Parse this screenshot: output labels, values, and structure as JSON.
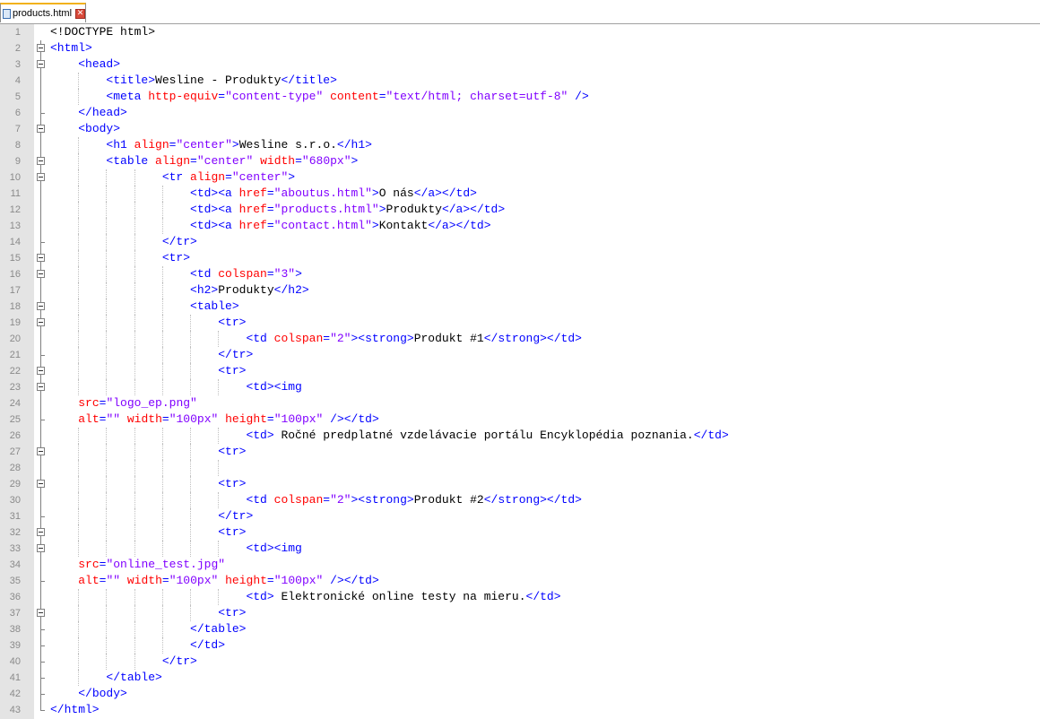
{
  "tab": {
    "file_icon": "html-file-icon",
    "label": "products.html",
    "close_icon": "close-icon"
  },
  "colors": {
    "tag": "#0000ff",
    "attribute": "#ff0000",
    "value": "#8000ff",
    "text": "#000000",
    "gutter": "#e4e4e4"
  },
  "lines": [
    {
      "n": "1",
      "fold": "none",
      "segs": [
        [
          "x",
          "<!DOCTYPE html>"
        ]
      ]
    },
    {
      "n": "2",
      "fold": "open",
      "segs": [
        [
          "t",
          "<html>"
        ]
      ]
    },
    {
      "n": "3",
      "fold": "open",
      "segs": [
        [
          "x",
          "    "
        ],
        [
          "t",
          "<head>"
        ]
      ]
    },
    {
      "n": "4",
      "fold": "line",
      "segs": [
        [
          "x",
          "        "
        ],
        [
          "t",
          "<title>"
        ],
        [
          "x",
          "Wesline - Produkty"
        ],
        [
          "t",
          "</title>"
        ]
      ]
    },
    {
      "n": "5",
      "fold": "line",
      "segs": [
        [
          "x",
          "        "
        ],
        [
          "t",
          "<meta "
        ],
        [
          "a",
          "http-equiv"
        ],
        [
          "t",
          "="
        ],
        [
          "v",
          "\"content-type\""
        ],
        [
          "t",
          " "
        ],
        [
          "a",
          "content"
        ],
        [
          "t",
          "="
        ],
        [
          "v",
          "\"text/html; charset=utf-8\""
        ],
        [
          "t",
          " />"
        ]
      ]
    },
    {
      "n": "6",
      "fold": "end",
      "segs": [
        [
          "x",
          "    "
        ],
        [
          "t",
          "</head>"
        ]
      ]
    },
    {
      "n": "7",
      "fold": "open",
      "segs": [
        [
          "x",
          "    "
        ],
        [
          "t",
          "<body>"
        ]
      ]
    },
    {
      "n": "8",
      "fold": "line",
      "segs": [
        [
          "x",
          "        "
        ],
        [
          "t",
          "<h1 "
        ],
        [
          "a",
          "align"
        ],
        [
          "t",
          "="
        ],
        [
          "v",
          "\"center\""
        ],
        [
          "t",
          ">"
        ],
        [
          "x",
          "Wesline s.r.o."
        ],
        [
          "t",
          "</h1>"
        ]
      ]
    },
    {
      "n": "9",
      "fold": "open",
      "segs": [
        [
          "x",
          "        "
        ],
        [
          "t",
          "<table "
        ],
        [
          "a",
          "align"
        ],
        [
          "t",
          "="
        ],
        [
          "v",
          "\"center\""
        ],
        [
          "t",
          " "
        ],
        [
          "a",
          "width"
        ],
        [
          "t",
          "="
        ],
        [
          "v",
          "\"680px\""
        ],
        [
          "t",
          ">"
        ]
      ]
    },
    {
      "n": "10",
      "fold": "open",
      "segs": [
        [
          "x",
          "                "
        ],
        [
          "t",
          "<tr "
        ],
        [
          "a",
          "align"
        ],
        [
          "t",
          "="
        ],
        [
          "v",
          "\"center\""
        ],
        [
          "t",
          ">"
        ]
      ]
    },
    {
      "n": "11",
      "fold": "line",
      "segs": [
        [
          "x",
          "                    "
        ],
        [
          "t",
          "<td><a "
        ],
        [
          "a",
          "href"
        ],
        [
          "t",
          "="
        ],
        [
          "v",
          "\"aboutus.html\""
        ],
        [
          "t",
          ">"
        ],
        [
          "x",
          "O nás"
        ],
        [
          "t",
          "</a></td>"
        ]
      ]
    },
    {
      "n": "12",
      "fold": "line",
      "segs": [
        [
          "x",
          "                    "
        ],
        [
          "t",
          "<td><a "
        ],
        [
          "a",
          "href"
        ],
        [
          "t",
          "="
        ],
        [
          "v",
          "\"products.html\""
        ],
        [
          "t",
          ">"
        ],
        [
          "x",
          "Produkty"
        ],
        [
          "t",
          "</a></td>"
        ]
      ]
    },
    {
      "n": "13",
      "fold": "line",
      "segs": [
        [
          "x",
          "                    "
        ],
        [
          "t",
          "<td><a "
        ],
        [
          "a",
          "href"
        ],
        [
          "t",
          "="
        ],
        [
          "v",
          "\"contact.html\""
        ],
        [
          "t",
          ">"
        ],
        [
          "x",
          "Kontakt"
        ],
        [
          "t",
          "</a></td>"
        ]
      ]
    },
    {
      "n": "14",
      "fold": "end",
      "segs": [
        [
          "x",
          "                "
        ],
        [
          "t",
          "</tr>"
        ]
      ]
    },
    {
      "n": "15",
      "fold": "open",
      "segs": [
        [
          "x",
          "                "
        ],
        [
          "t",
          "<tr>"
        ]
      ]
    },
    {
      "n": "16",
      "fold": "open",
      "segs": [
        [
          "x",
          "                    "
        ],
        [
          "t",
          "<td "
        ],
        [
          "a",
          "colspan"
        ],
        [
          "t",
          "="
        ],
        [
          "v",
          "\"3\""
        ],
        [
          "t",
          ">"
        ]
      ]
    },
    {
      "n": "17",
      "fold": "line",
      "segs": [
        [
          "x",
          "                    "
        ],
        [
          "t",
          "<h2>"
        ],
        [
          "x",
          "Produkty"
        ],
        [
          "t",
          "</h2>"
        ]
      ]
    },
    {
      "n": "18",
      "fold": "open",
      "segs": [
        [
          "x",
          "                    "
        ],
        [
          "t",
          "<table>"
        ]
      ]
    },
    {
      "n": "19",
      "fold": "open",
      "segs": [
        [
          "x",
          "                        "
        ],
        [
          "t",
          "<tr>"
        ]
      ]
    },
    {
      "n": "20",
      "fold": "line",
      "segs": [
        [
          "x",
          "                            "
        ],
        [
          "t",
          "<td "
        ],
        [
          "a",
          "colspan"
        ],
        [
          "t",
          "="
        ],
        [
          "v",
          "\"2\""
        ],
        [
          "t",
          "><strong>"
        ],
        [
          "x",
          "Produkt #1"
        ],
        [
          "t",
          "</strong></td>"
        ]
      ]
    },
    {
      "n": "21",
      "fold": "end",
      "segs": [
        [
          "x",
          "                        "
        ],
        [
          "t",
          "</tr>"
        ]
      ]
    },
    {
      "n": "22",
      "fold": "open",
      "segs": [
        [
          "x",
          "                        "
        ],
        [
          "t",
          "<tr>"
        ]
      ]
    },
    {
      "n": "23",
      "fold": "open",
      "segs": [
        [
          "x",
          "                            "
        ],
        [
          "t",
          "<td><img"
        ]
      ]
    },
    {
      "n": "24",
      "fold": "line",
      "segs": [
        [
          "x",
          "    "
        ],
        [
          "a",
          "src"
        ],
        [
          "t",
          "="
        ],
        [
          "v",
          "\"logo_ep.png\""
        ]
      ]
    },
    {
      "n": "25",
      "fold": "end",
      "segs": [
        [
          "x",
          "    "
        ],
        [
          "a",
          "alt"
        ],
        [
          "t",
          "="
        ],
        [
          "v",
          "\"\""
        ],
        [
          "t",
          " "
        ],
        [
          "a",
          "width"
        ],
        [
          "t",
          "="
        ],
        [
          "v",
          "\"100px\""
        ],
        [
          "t",
          " "
        ],
        [
          "a",
          "height"
        ],
        [
          "t",
          "="
        ],
        [
          "v",
          "\"100px\""
        ],
        [
          "t",
          " /></td>"
        ]
      ]
    },
    {
      "n": "26",
      "fold": "line",
      "segs": [
        [
          "x",
          "                            "
        ],
        [
          "t",
          "<td>"
        ],
        [
          "x",
          " Ročné predplatné vzdelávacie portálu Encyklopédia poznania."
        ],
        [
          "t",
          "</td>"
        ]
      ]
    },
    {
      "n": "27",
      "fold": "open",
      "segs": [
        [
          "x",
          "                        "
        ],
        [
          "t",
          "<tr>"
        ]
      ]
    },
    {
      "n": "28",
      "fold": "line",
      "segs": []
    },
    {
      "n": "29",
      "fold": "open",
      "segs": [
        [
          "x",
          "                        "
        ],
        [
          "t",
          "<tr>"
        ]
      ]
    },
    {
      "n": "30",
      "fold": "line",
      "segs": [
        [
          "x",
          "                            "
        ],
        [
          "t",
          "<td "
        ],
        [
          "a",
          "colspan"
        ],
        [
          "t",
          "="
        ],
        [
          "v",
          "\"2\""
        ],
        [
          "t",
          "><strong>"
        ],
        [
          "x",
          "Produkt #2"
        ],
        [
          "t",
          "</strong></td>"
        ]
      ]
    },
    {
      "n": "31",
      "fold": "end",
      "segs": [
        [
          "x",
          "                        "
        ],
        [
          "t",
          "</tr>"
        ]
      ]
    },
    {
      "n": "32",
      "fold": "open",
      "segs": [
        [
          "x",
          "                        "
        ],
        [
          "t",
          "<tr>"
        ]
      ]
    },
    {
      "n": "33",
      "fold": "open",
      "segs": [
        [
          "x",
          "                            "
        ],
        [
          "t",
          "<td><img"
        ]
      ]
    },
    {
      "n": "34",
      "fold": "line",
      "segs": [
        [
          "x",
          "    "
        ],
        [
          "a",
          "src"
        ],
        [
          "t",
          "="
        ],
        [
          "v",
          "\"online_test.jpg\""
        ]
      ]
    },
    {
      "n": "35",
      "fold": "end",
      "segs": [
        [
          "x",
          "    "
        ],
        [
          "a",
          "alt"
        ],
        [
          "t",
          "="
        ],
        [
          "v",
          "\"\""
        ],
        [
          "t",
          " "
        ],
        [
          "a",
          "width"
        ],
        [
          "t",
          "="
        ],
        [
          "v",
          "\"100px\""
        ],
        [
          "t",
          " "
        ],
        [
          "a",
          "height"
        ],
        [
          "t",
          "="
        ],
        [
          "v",
          "\"100px\""
        ],
        [
          "t",
          " /></td>"
        ]
      ]
    },
    {
      "n": "36",
      "fold": "line",
      "segs": [
        [
          "x",
          "                            "
        ],
        [
          "t",
          "<td>"
        ],
        [
          "x",
          " Elektronické online testy na mieru."
        ],
        [
          "t",
          "</td>"
        ]
      ]
    },
    {
      "n": "37",
      "fold": "open",
      "segs": [
        [
          "x",
          "                        "
        ],
        [
          "t",
          "<tr>"
        ]
      ]
    },
    {
      "n": "38",
      "fold": "end",
      "segs": [
        [
          "x",
          "                    "
        ],
        [
          "t",
          "</table>"
        ]
      ]
    },
    {
      "n": "39",
      "fold": "end",
      "segs": [
        [
          "x",
          "                    "
        ],
        [
          "t",
          "</td>"
        ]
      ]
    },
    {
      "n": "40",
      "fold": "end",
      "segs": [
        [
          "x",
          "                "
        ],
        [
          "t",
          "</tr>"
        ]
      ]
    },
    {
      "n": "41",
      "fold": "end",
      "segs": [
        [
          "x",
          "        "
        ],
        [
          "t",
          "</table>"
        ]
      ]
    },
    {
      "n": "42",
      "fold": "end",
      "segs": [
        [
          "x",
          "    "
        ],
        [
          "t",
          "</body>"
        ]
      ]
    },
    {
      "n": "43",
      "fold": "last",
      "segs": [
        [
          "t",
          "</html>"
        ]
      ]
    }
  ]
}
